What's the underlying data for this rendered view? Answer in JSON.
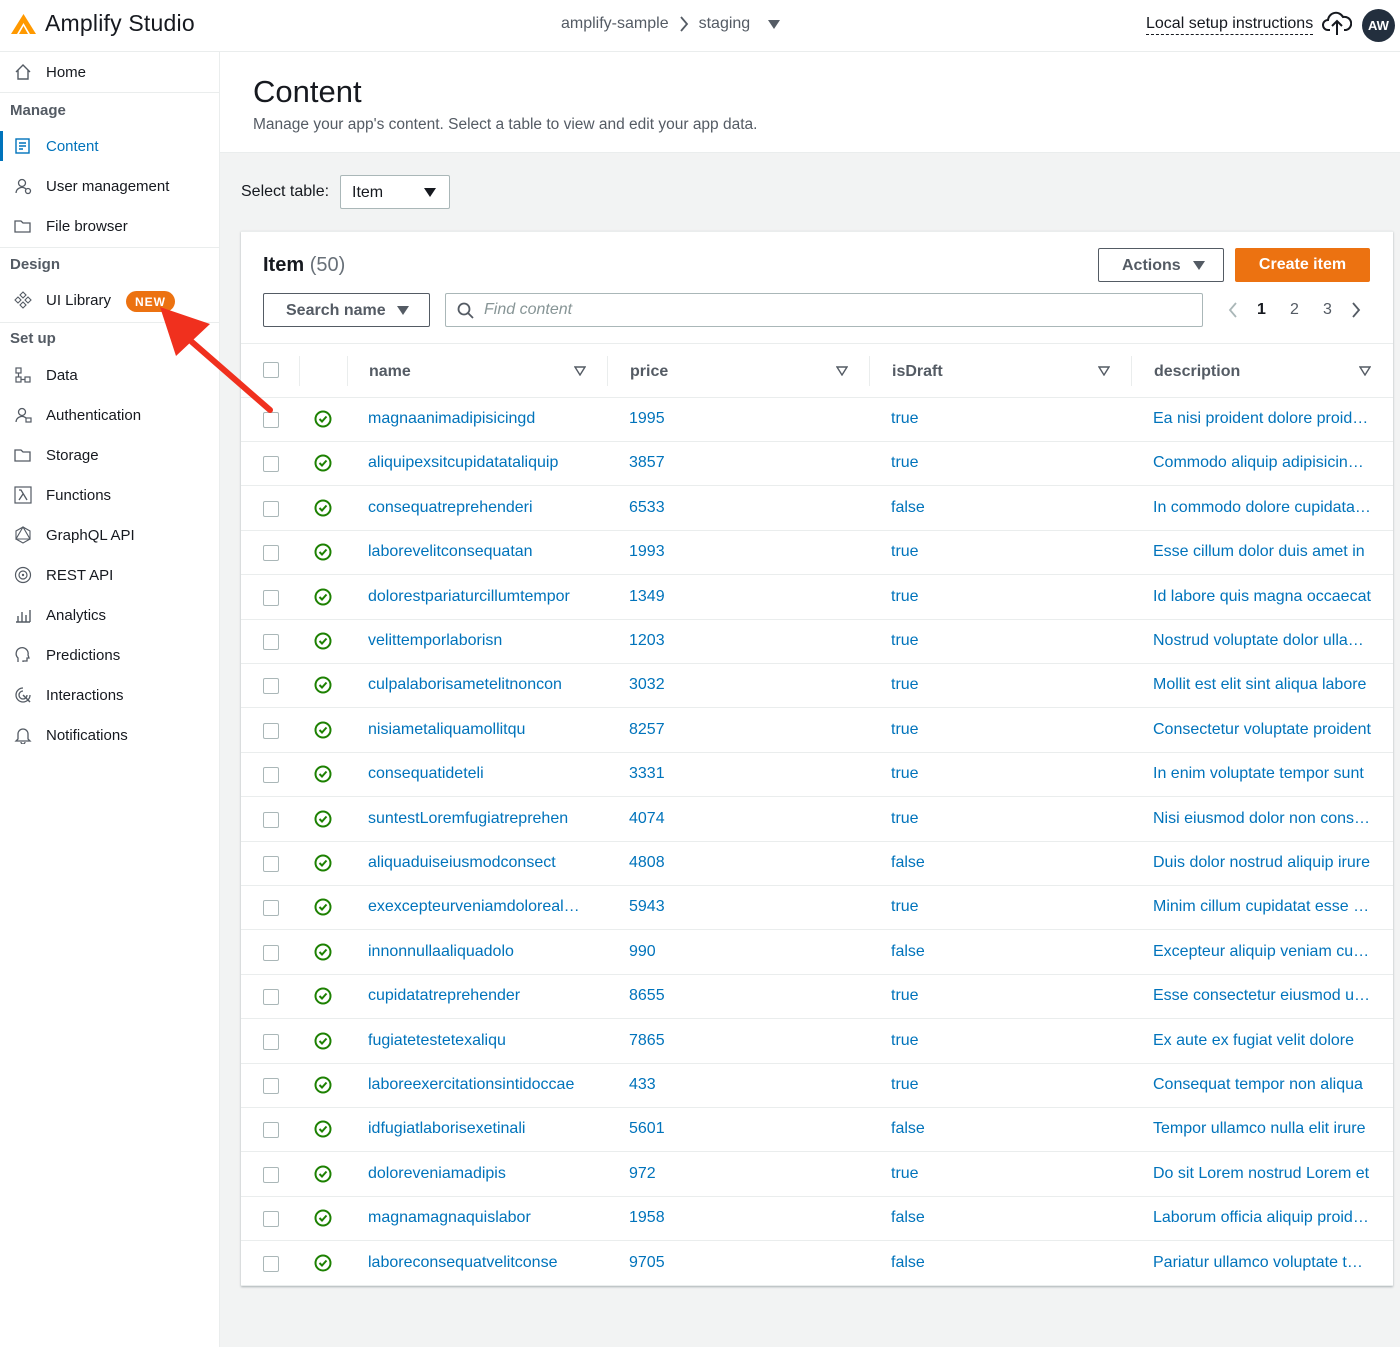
{
  "app": {
    "name": "Amplify Studio",
    "breadcrumb": [
      "amplify-sample",
      "staging"
    ],
    "local_setup": "Local setup instructions",
    "avatar_initials": "AW",
    "accent_color": "#ec7211",
    "link_color": "#0073bb"
  },
  "sidebar": {
    "home": "Home",
    "manage_heading": "Manage",
    "manage_items": [
      {
        "label": "Content",
        "icon": "content-icon",
        "active": true
      },
      {
        "label": "User management",
        "icon": "users-icon"
      },
      {
        "label": "File browser",
        "icon": "folder-icon"
      }
    ],
    "design_heading": "Design",
    "design_items": [
      {
        "label": "UI Library",
        "icon": "components-icon",
        "badge": "NEW"
      }
    ],
    "setup_heading": "Set up",
    "setup_items": [
      {
        "label": "Data",
        "icon": "data-icon"
      },
      {
        "label": "Authentication",
        "icon": "auth-icon"
      },
      {
        "label": "Storage",
        "icon": "storage-icon"
      },
      {
        "label": "Functions",
        "icon": "lambda-icon"
      },
      {
        "label": "GraphQL API",
        "icon": "graphql-icon"
      },
      {
        "label": "REST API",
        "icon": "rest-icon"
      },
      {
        "label": "Analytics",
        "icon": "analytics-icon"
      },
      {
        "label": "Predictions",
        "icon": "predictions-icon"
      },
      {
        "label": "Interactions",
        "icon": "interactions-icon"
      },
      {
        "label": "Notifications",
        "icon": "bell-icon"
      }
    ]
  },
  "page": {
    "title": "Content",
    "subtitle": "Manage your app's content. Select a table to view and edit your app data.",
    "select_label": "Select table:",
    "selected_table": "Item"
  },
  "panel": {
    "title": "Item",
    "count": "(50)",
    "actions_label": "Actions",
    "create_label": "Create item",
    "search_filter_label": "Search name",
    "find_placeholder": "Find content",
    "pages": [
      "1",
      "2",
      "3"
    ],
    "current_page": "1"
  },
  "table": {
    "columns": [
      "name",
      "price",
      "isDraft",
      "description"
    ],
    "rows": [
      {
        "name": "magnaanimadipisicingd",
        "price": "1995",
        "isDraft": "true",
        "description": "Ea nisi proident dolore proident"
      },
      {
        "name": "aliquipexsitcupidatataliquip",
        "price": "3857",
        "isDraft": "true",
        "description": "Commodo aliquip adipisicing elit"
      },
      {
        "name": "consequatreprehenderi",
        "price": "6533",
        "isDraft": "false",
        "description": "In commodo dolore cupidatat est"
      },
      {
        "name": "laborevelitconsequatan",
        "price": "1993",
        "isDraft": "true",
        "description": "Esse cillum dolor duis amet in"
      },
      {
        "name": "dolorestpariaturcillumtempor",
        "price": "1349",
        "isDraft": "true",
        "description": "Id labore quis magna occaecat"
      },
      {
        "name": "velittemporlaborisn",
        "price": "1203",
        "isDraft": "true",
        "description": "Nostrud voluptate dolor ullamco"
      },
      {
        "name": "culpalaborisametelitnoncon",
        "price": "3032",
        "isDraft": "true",
        "description": "Mollit est elit sint aliqua labore"
      },
      {
        "name": "nisiametaliquamollitqu",
        "price": "8257",
        "isDraft": "true",
        "description": "Consectetur voluptate proident"
      },
      {
        "name": "consequatideteli",
        "price": "3331",
        "isDraft": "true",
        "description": "In enim voluptate tempor sunt"
      },
      {
        "name": "suntestLoremfugiatreprehen",
        "price": "4074",
        "isDraft": "true",
        "description": "Nisi eiusmod dolor non consequat"
      },
      {
        "name": "aliquaduiseiusmodconsect",
        "price": "4808",
        "isDraft": "false",
        "description": "Duis dolor nostrud aliquip irure"
      },
      {
        "name": "exexcepteurveniamdolorealiqu",
        "price": "5943",
        "isDraft": "true",
        "description": "Minim cillum cupidatat esse est"
      },
      {
        "name": "innonnullaaliquadolo",
        "price": "990",
        "isDraft": "false",
        "description": "Excepteur aliquip veniam culpa"
      },
      {
        "name": "cupidatatreprehender",
        "price": "8655",
        "isDraft": "true",
        "description": "Esse consectetur eiusmod ullamco"
      },
      {
        "name": "fugiatetestetexaliqu",
        "price": "7865",
        "isDraft": "true",
        "description": "Ex aute ex fugiat velit dolore"
      },
      {
        "name": "laboreexercitationsintidoccae",
        "price": "433",
        "isDraft": "true",
        "description": "Consequat tempor non aliqua"
      },
      {
        "name": "idfugiatlaborisexetinali",
        "price": "5601",
        "isDraft": "false",
        "description": "Tempor ullamco nulla elit irure"
      },
      {
        "name": "doloreveniamadipis",
        "price": "972",
        "isDraft": "true",
        "description": "Do sit Lorem nostrud Lorem et"
      },
      {
        "name": "magnamagnaquislabor",
        "price": "1958",
        "isDraft": "false",
        "description": "Laborum officia aliquip proident"
      },
      {
        "name": "laboreconsequatvelitconse",
        "price": "9705",
        "isDraft": "false",
        "description": "Pariatur ullamco voluptate tempor"
      }
    ]
  }
}
